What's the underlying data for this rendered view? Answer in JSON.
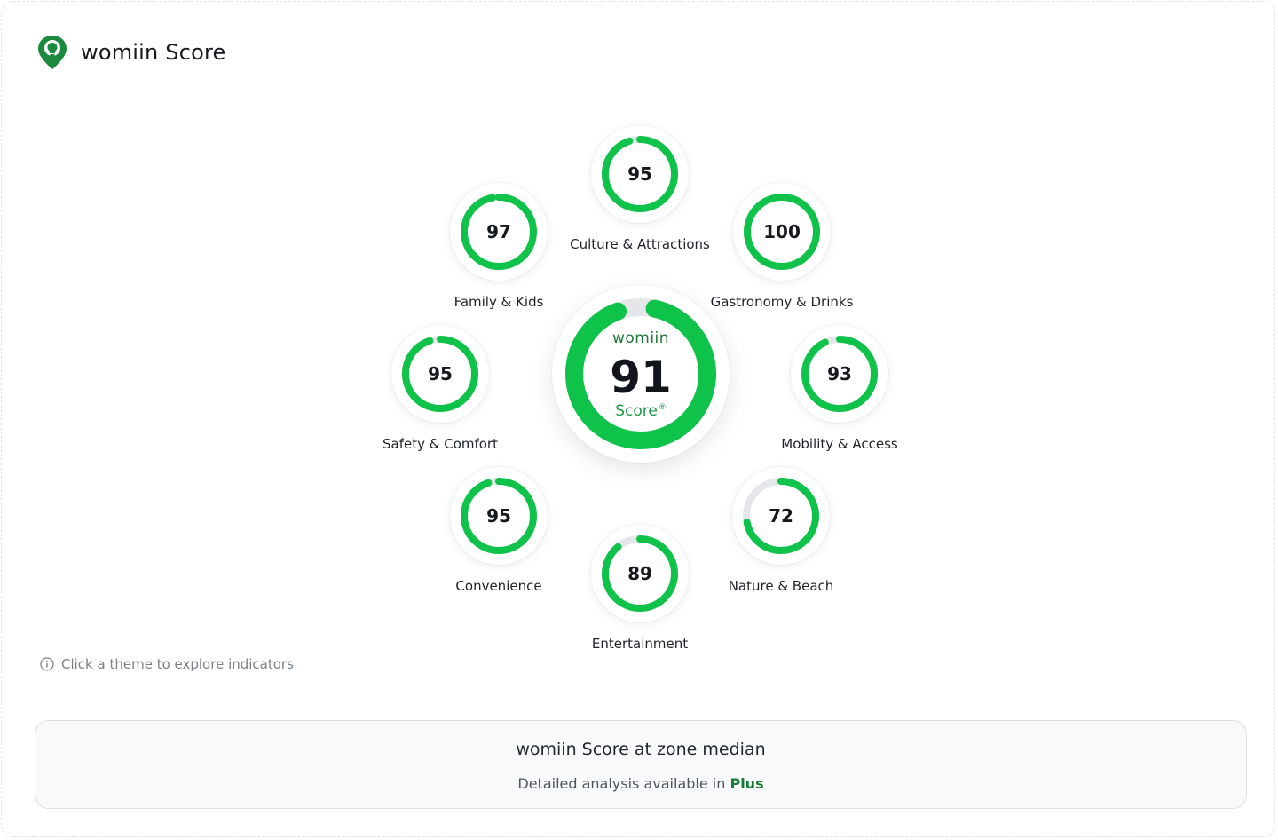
{
  "brand": {
    "title": "womiin Score",
    "accent": "#1b8a3e"
  },
  "colors": {
    "progress": "#0fc24a",
    "track": "#e4e6e9"
  },
  "center": {
    "brand_text": "womiin",
    "value": "91",
    "score_text": "Score",
    "reg_mark": "®",
    "fraction": 0.91
  },
  "themes": [
    {
      "label": "Culture & Attractions",
      "value": "95",
      "fraction": 0.95
    },
    {
      "label": "Gastronomy & Drinks",
      "value": "100",
      "fraction": 1.0
    },
    {
      "label": "Mobility & Access",
      "value": "93",
      "fraction": 0.93
    },
    {
      "label": "Nature & Beach",
      "value": "72",
      "fraction": 0.72
    },
    {
      "label": "Entertainment",
      "value": "89",
      "fraction": 0.89
    },
    {
      "label": "Convenience",
      "value": "95",
      "fraction": 0.95
    },
    {
      "label": "Safety & Comfort",
      "value": "95",
      "fraction": 0.95
    },
    {
      "label": "Family & Kids",
      "value": "97",
      "fraction": 0.97
    }
  ],
  "hint": {
    "text": "Click a theme to explore indicators",
    "icon": "info-icon"
  },
  "bottom": {
    "title": "womiin Score at zone median",
    "subtitle_prefix": "Detailed analysis available in",
    "plus_label": "Plus"
  }
}
